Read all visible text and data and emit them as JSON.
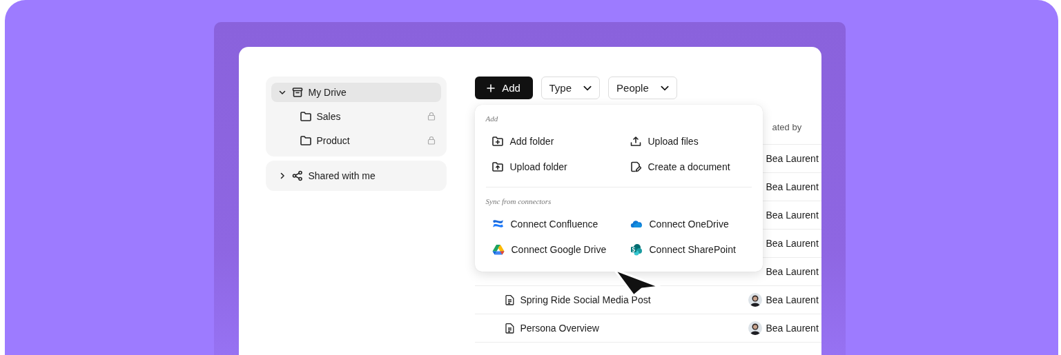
{
  "sidebar": {
    "sections": [
      {
        "label": "My Drive",
        "expanded": true,
        "selected": true,
        "children": [
          {
            "label": "Sales",
            "locked": true
          },
          {
            "label": "Product",
            "locked": true
          }
        ]
      },
      {
        "label": "Shared with me",
        "expanded": false,
        "selected": false
      }
    ]
  },
  "toolbar": {
    "add_button": {
      "label": "Add"
    },
    "filters": [
      {
        "label": "Type"
      },
      {
        "label": "People"
      }
    ]
  },
  "table": {
    "header": "ated by",
    "rows": [
      {
        "avatar": false,
        "created_by": "Bea Laurent"
      },
      {
        "avatar": false,
        "created_by": "Bea Laurent"
      },
      {
        "avatar": false,
        "created_by": "Bea Laurent"
      },
      {
        "avatar": false,
        "created_by": "Bea Laurent"
      },
      {
        "avatar": false,
        "created_by": "Bea Laurent"
      },
      {
        "file": "Spring Ride Social Media Post",
        "avatar": true,
        "created_by": "Bea Laurent"
      },
      {
        "file": "Persona Overview",
        "avatar": true,
        "created_by": "Bea Laurent"
      }
    ]
  },
  "menu": {
    "sections": [
      {
        "title": "Add",
        "items": [
          {
            "label": "Add folder"
          },
          {
            "label": "Upload files"
          },
          {
            "label": "Upload folder"
          },
          {
            "label": "Create a document"
          }
        ]
      },
      {
        "title": "Sync from connectors",
        "items": [
          {
            "label": "Connect Confluence"
          },
          {
            "label": "Connect OneDrive"
          },
          {
            "label": "Connect Google Drive"
          },
          {
            "label": "Connect SharePoint"
          }
        ]
      }
    ]
  }
}
